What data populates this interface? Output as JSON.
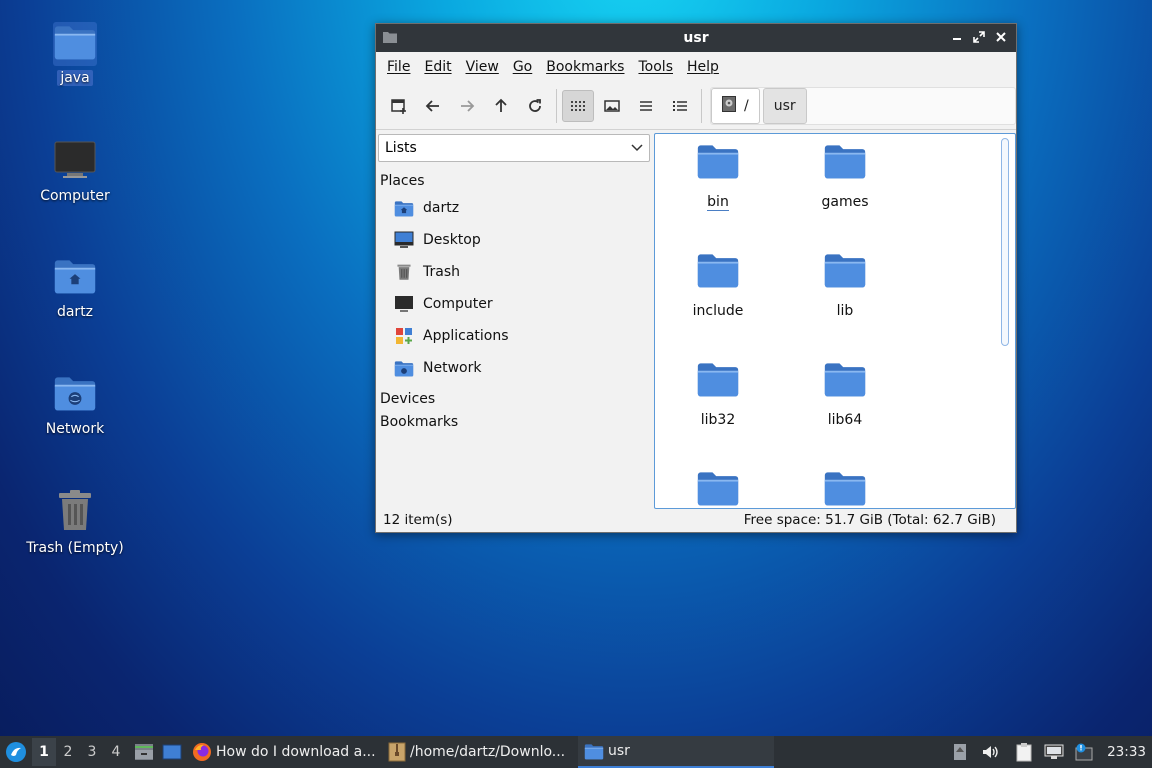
{
  "desktop": {
    "icons": [
      {
        "label": "java"
      },
      {
        "label": "Computer"
      },
      {
        "label": "dartz"
      },
      {
        "label": "Network"
      },
      {
        "label": "Trash (Empty)"
      }
    ]
  },
  "window": {
    "title": "usr",
    "menu": [
      "File",
      "Edit",
      "View",
      "Go",
      "Bookmarks",
      "Tools",
      "Help"
    ],
    "path": {
      "root": "/",
      "current": "usr"
    },
    "side": {
      "combo_value": "Lists",
      "places_heading": "Places",
      "places": [
        "dartz",
        "Desktop",
        "Trash",
        "Computer",
        "Applications",
        "Network"
      ],
      "devices_heading": "Devices",
      "bookmarks_heading": "Bookmarks"
    },
    "folders": [
      "bin",
      "games",
      "include",
      "lib",
      "lib32",
      "lib64"
    ],
    "status": {
      "count": "12 item(s)",
      "space": "Free space: 51.7 GiB (Total: 62.7 GiB)"
    }
  },
  "taskbar": {
    "workspaces": [
      "1",
      "2",
      "3",
      "4"
    ],
    "tasks": [
      "How do I download a...",
      "/home/dartz/Downlo...",
      "usr"
    ],
    "clock": "23:33"
  },
  "colors": {
    "folder": "#4a86d6",
    "accent": "#3d7fd6",
    "titlebar": "#31363b"
  }
}
